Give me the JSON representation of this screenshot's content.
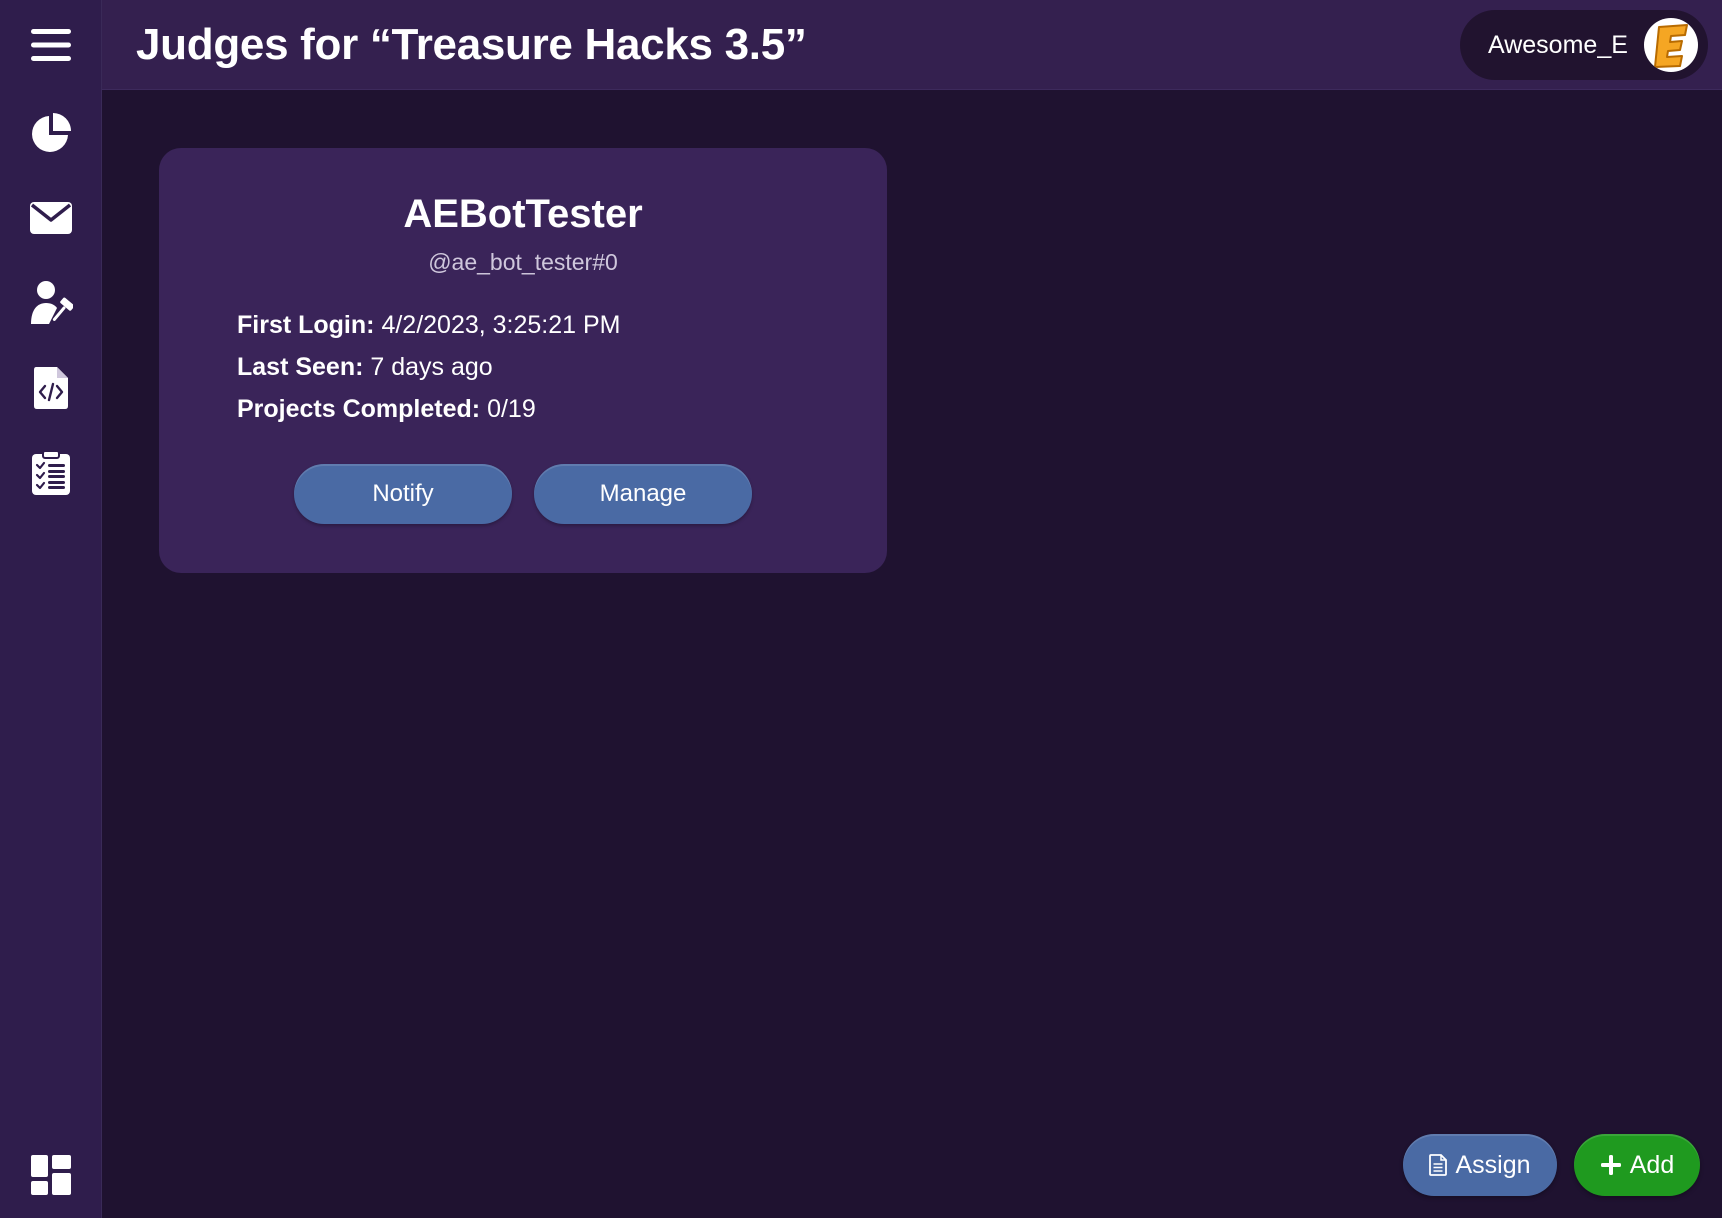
{
  "header": {
    "title": "Judges for “Treasure Hacks 3.5”",
    "username": "Awesome_E",
    "avatar_letter": "E"
  },
  "sidebar": {
    "items": [
      {
        "name": "menu",
        "icon": "hamburger-menu-icon"
      },
      {
        "name": "stats",
        "icon": "pie-chart-icon"
      },
      {
        "name": "messages",
        "icon": "envelope-icon"
      },
      {
        "name": "judges",
        "icon": "judge-gavel-icon"
      },
      {
        "name": "projects",
        "icon": "code-file-icon"
      },
      {
        "name": "checklist",
        "icon": "clipboard-checklist-icon"
      },
      {
        "name": "dashboard",
        "icon": "dashboard-grid-icon"
      }
    ]
  },
  "judge_card": {
    "name": "AEBotTester",
    "handle": "@ae_bot_tester#0",
    "first_login_label": "First Login:",
    "first_login_value": "4/2/2023, 3:25:21 PM",
    "last_seen_label": "Last Seen:",
    "last_seen_value": "7 days ago",
    "projects_label": "Projects Completed:",
    "projects_value": "0/19",
    "notify_label": "Notify",
    "manage_label": "Manage"
  },
  "actions": {
    "assign_label": "Assign",
    "add_label": "Add"
  },
  "colors": {
    "background": "#1f1230",
    "sidebar": "#2f1d4c",
    "header": "#34204f",
    "card": "#3a2459",
    "button_blue": "#4a6aa4",
    "button_green": "#1f9a1f",
    "avatar_accent": "#f5a623"
  }
}
